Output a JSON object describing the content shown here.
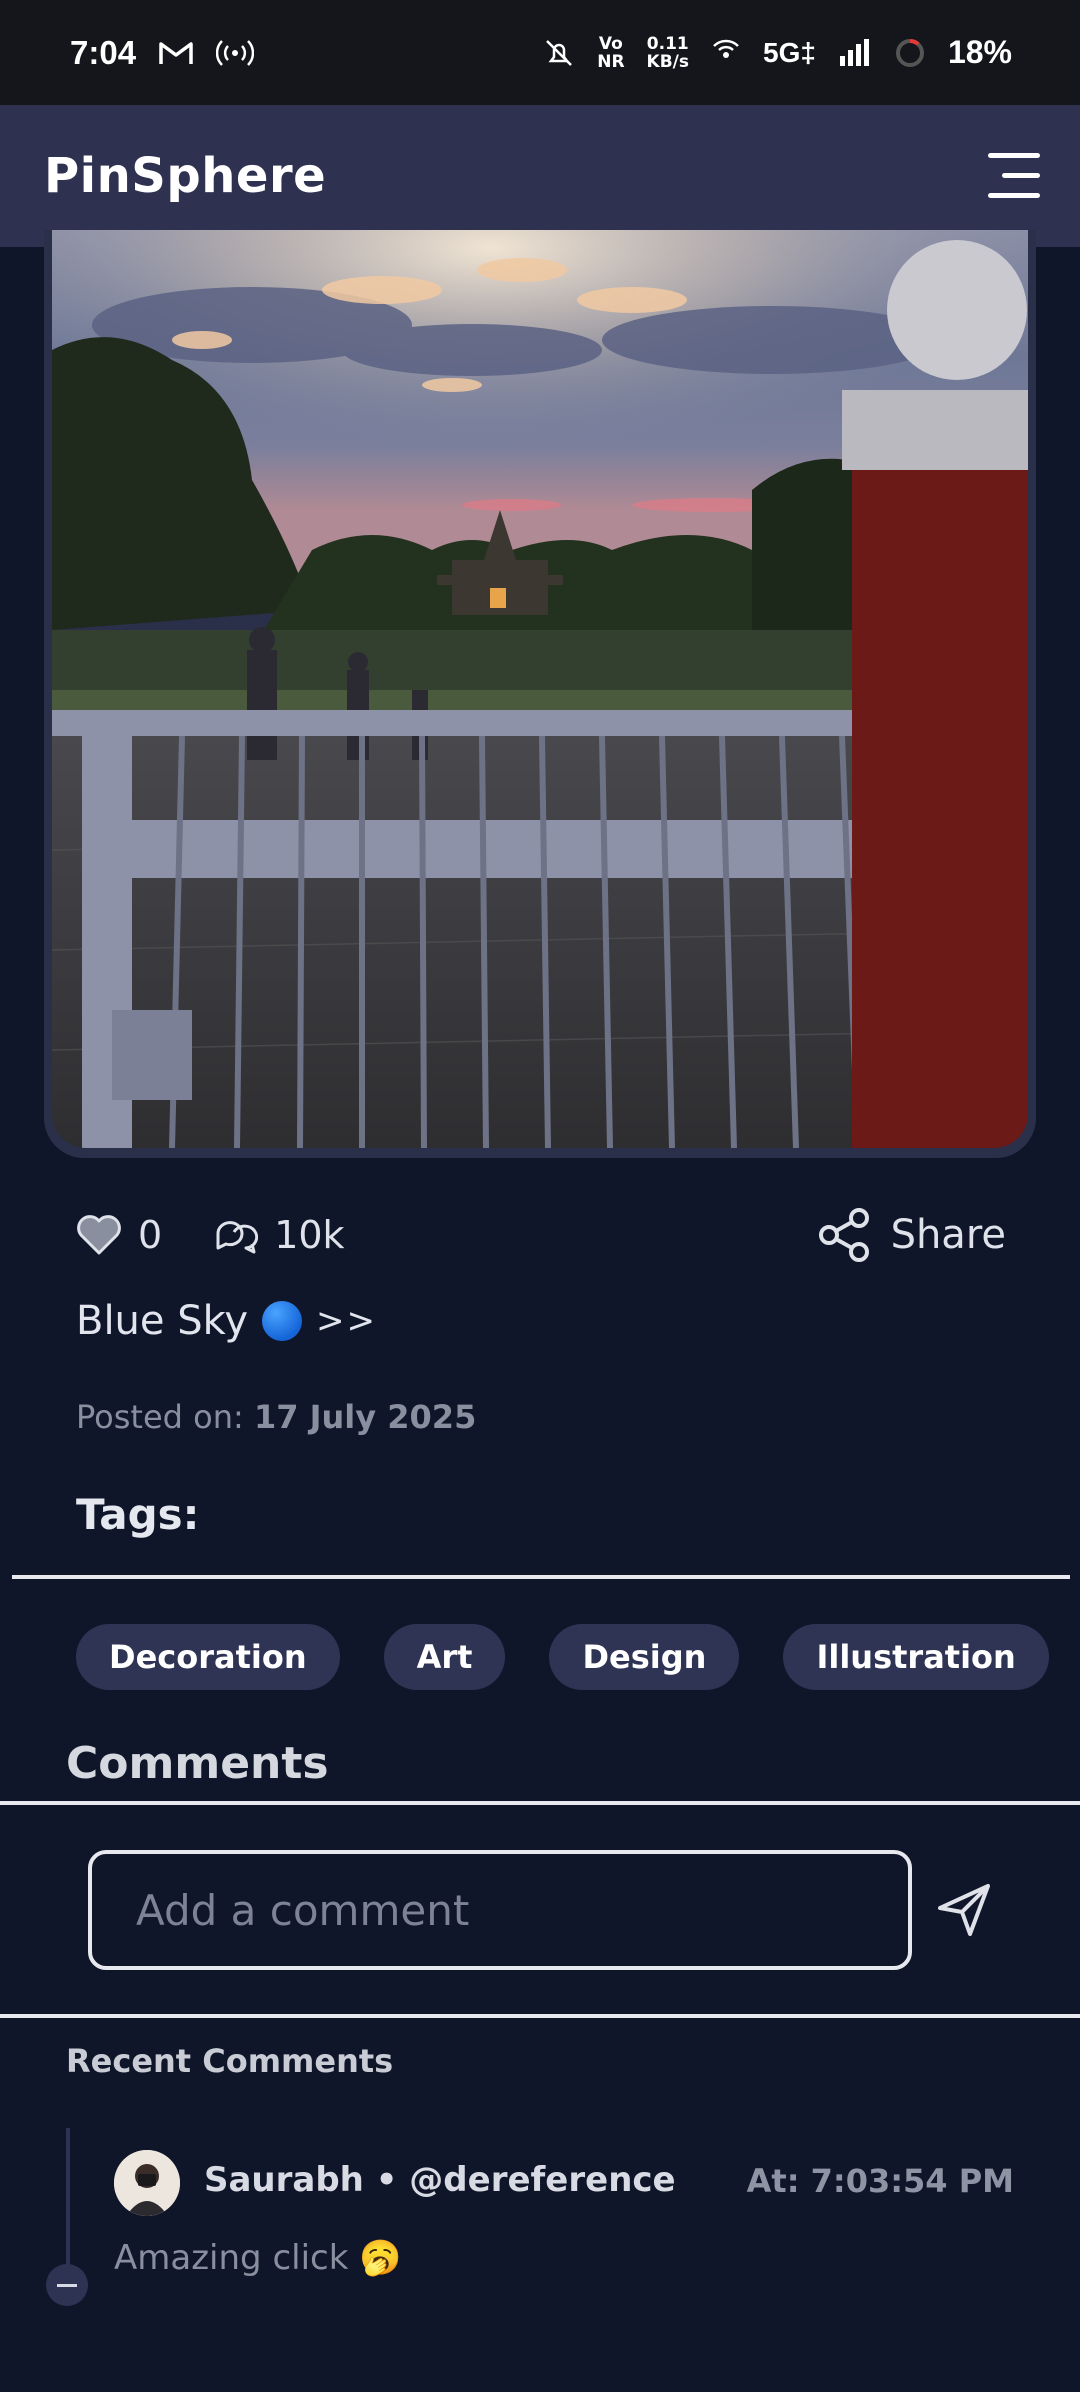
{
  "status_bar": {
    "time": "7:04",
    "net_speed_value": "0.11",
    "net_speed_unit": "KB/s",
    "vo_top": "Vo",
    "vo_bottom": "NR",
    "network": "5G‡",
    "battery": "18%",
    "icons": [
      "gmail-icon",
      "hotspot-icon",
      "mute-icon",
      "wifi-icon",
      "signal-icon",
      "battery-ring-icon"
    ]
  },
  "header": {
    "title": "PinSphere",
    "menu_icon": "hamburger-icon"
  },
  "post": {
    "image_alt": "Temple garden at sunset behind a metal gate",
    "likes": "0",
    "comments_count": "10k",
    "share_label": "Share",
    "title": "Blue Sky",
    "title_suffix": ">>",
    "posted_prefix": "Posted on: ",
    "posted_date": "17 July 2025"
  },
  "tags": {
    "label": "Tags:",
    "items": [
      "Decoration",
      "Art",
      "Design",
      "Illustration"
    ]
  },
  "comments": {
    "label": "Comments",
    "input_placeholder": "Add a comment",
    "recent_label": "Recent Comments",
    "items": [
      {
        "author": "Saurabh • @dereference",
        "time": "At: 7:03:54 PM",
        "text": "Amazing click 🥱"
      }
    ]
  },
  "colors": {
    "background": "#0f1629",
    "header": "#2e3250",
    "tag_bg": "#2f3454",
    "status_bar": "#15161b"
  }
}
